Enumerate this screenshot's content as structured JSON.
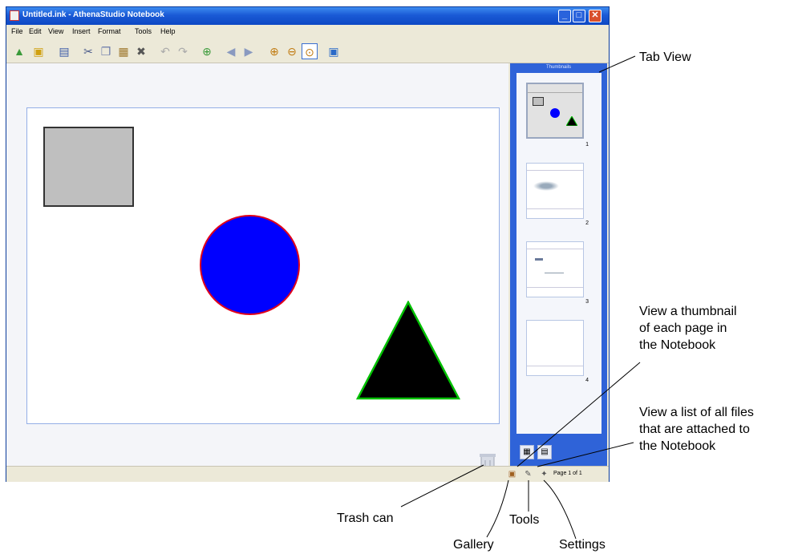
{
  "window": {
    "title": "Untitled.ink - AthenaStudio Notebook",
    "min_label": "_",
    "max_label": "□",
    "close_label": "✕"
  },
  "menu": [
    "File",
    "Edit",
    "View",
    "Insert",
    "Format",
    "Tools",
    "Help"
  ],
  "toolbar": {
    "icons": [
      "open-icon",
      "save-icon",
      "print-icon",
      "cut-icon",
      "copy-icon",
      "paste-icon",
      "delete-icon",
      "undo-icon",
      "redo-icon",
      "add-page-icon",
      "previous-page-icon",
      "next-page-icon",
      "zoom-in-icon",
      "zoom-out-icon",
      "zoom-fit-icon",
      "full-screen-icon"
    ]
  },
  "canvas": {
    "shapes": [
      {
        "type": "square",
        "fill": "#bfbfbf",
        "stroke": "#333333"
      },
      {
        "type": "circle",
        "fill": "#0000ff",
        "stroke": "#e0001a"
      },
      {
        "type": "triangle",
        "fill": "#000000",
        "stroke": "#00c000"
      }
    ]
  },
  "side_tab": {
    "header": "Thumbnails",
    "thumbnails": [
      {
        "number": "1"
      },
      {
        "number": "2"
      },
      {
        "number": "3"
      },
      {
        "number": "4"
      }
    ]
  },
  "statusbar": {
    "page_label": "Page 1 of 1"
  },
  "callouts": {
    "tab_view": "Tab View",
    "thumbnail_view": [
      "View a thumbnail",
      "of each page in",
      "the Notebook"
    ],
    "attachments": [
      "View a list of all files",
      "that are attached to",
      "the Notebook"
    ],
    "trash": "Trash can",
    "gallery": "Gallery",
    "tools": "Tools",
    "settings": "Settings"
  },
  "colors": {
    "titlebar": "#1a5ad6",
    "side_tab": "#2f63d8",
    "page_border": "#93aee6"
  }
}
